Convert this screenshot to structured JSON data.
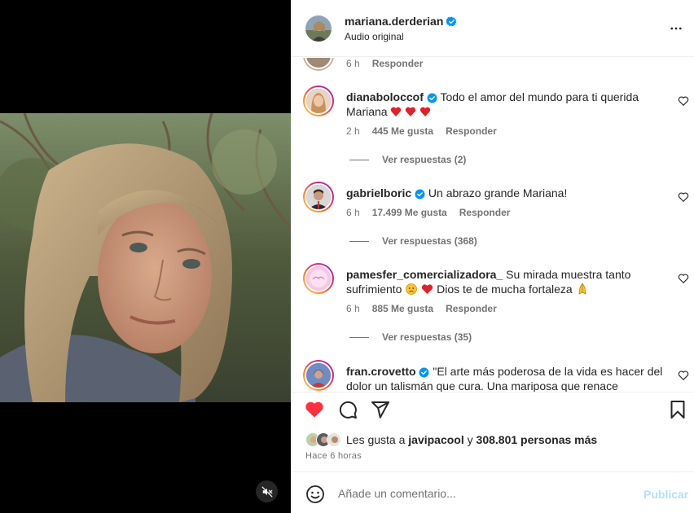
{
  "post": {
    "username": "mariana.derderian",
    "audio": "Audio original"
  },
  "comments": [
    {
      "id": "partial",
      "time": "6 h",
      "reply_label": "Responder"
    },
    {
      "username": "dianaboloccof",
      "text": "Todo el amor del mundo para ti querida Mariana",
      "emojis": "❤️❤️❤️",
      "time": "2 h",
      "likes": "445 Me gusta",
      "reply_label": "Responder",
      "view_replies": "Ver respuestas (2)"
    },
    {
      "username": "gabrielboric",
      "text": "Un abrazo grande Mariana!",
      "time": "6 h",
      "likes": "17.499 Me gusta",
      "reply_label": "Responder",
      "view_replies": "Ver respuestas (368)"
    },
    {
      "username": "pamesfer_comercializadora_",
      "text": "Su mirada muestra tanto sufrimiento",
      "text2": "Dios te de mucha fortaleza",
      "time": "6 h",
      "likes": "885 Me gusta",
      "reply_label": "Responder",
      "view_replies": "Ver respuestas (35)"
    },
    {
      "username": "fran.crovetto",
      "text": "\"El arte más poderosa de la vida es hacer del dolor un talismán que cura. Una mariposa que renace florecida"
    }
  ],
  "likes": {
    "prefix": "Les gusta a",
    "user": "javipacool",
    "joiner": "y",
    "others": "308.801 personas más"
  },
  "timestamp": "Hace 6 horas",
  "composer": {
    "placeholder": "Añade un comentario...",
    "publish_label": "Publicar"
  },
  "colors": {
    "like_red": "#ff3040",
    "verified_blue": "#0095f6",
    "publish_disabled": "#b2dffc"
  },
  "icons": [
    "more-icon",
    "heart-icon",
    "comment-icon",
    "share-icon",
    "save-icon",
    "emoji-icon",
    "mute-icon",
    "verified-icon"
  ]
}
